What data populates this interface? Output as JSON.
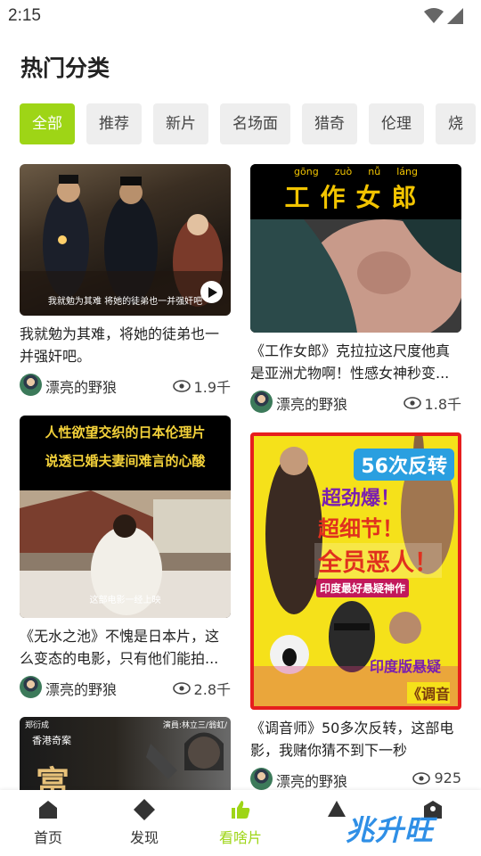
{
  "status": {
    "time": "2:15"
  },
  "page_title": "热门分类",
  "categories": [
    {
      "label": "全部",
      "active": true
    },
    {
      "label": "推荐"
    },
    {
      "label": "新片"
    },
    {
      "label": "名场面"
    },
    {
      "label": "猎奇"
    },
    {
      "label": "伦理"
    },
    {
      "label": "烧"
    }
  ],
  "cards": [
    {
      "title": "我就勉为其难，将她的徒弟也一并强奸吧。",
      "author": "漂亮的野狼",
      "views": "1.9千",
      "subtitle": "我就勉为其难 将她的徒弟也一并强奸吧"
    },
    {
      "title": "《工作女郎》克拉拉这尺度他真是亚洲尤物啊！性感女神秒变...",
      "author": "漂亮的野狼",
      "views": "1.8千",
      "pinyin": [
        "gōng",
        "zuò",
        "nǚ",
        "láng"
      ],
      "poster_text": "工作女郎"
    },
    {
      "title": "《无水之池》不愧是日本片，这么变态的电影，只有他们能拍...",
      "author": "漂亮的野狼",
      "views": "2.8千",
      "banner_line1": "人性欲望交织的日本伦理片",
      "banner_line2": "说透已婚夫妻间难言的心酸",
      "subtitle": "这部电影一经上映"
    },
    {
      "title": "《调音师》50多次反转，这部电影，我赌你猜不到下一秒",
      "author": "漂亮的野狼",
      "views": "925",
      "poster_line1": "56次反转",
      "poster_line2": "超劲爆！",
      "poster_line3": "超细节！",
      "poster_line4": "全员恶人！",
      "poster_line5": "印度最好悬疑神作",
      "poster_line6": "印度版悬疑",
      "poster_line7": "《调音"
    },
    {
      "poster_left": "郑衍成",
      "poster_right": "演員:林立三/翁虹/",
      "poster_sub": "香港奇案",
      "poster_big": "富"
    }
  ],
  "tabs": [
    {
      "label": "首页"
    },
    {
      "label": "发现"
    },
    {
      "label": "看啥片",
      "active": true
    },
    {
      "label": ""
    },
    {
      "label": ""
    }
  ],
  "watermark": "兆升旺",
  "colors": {
    "accent": "#9ed516",
    "chip_bg": "#eeeeee"
  }
}
